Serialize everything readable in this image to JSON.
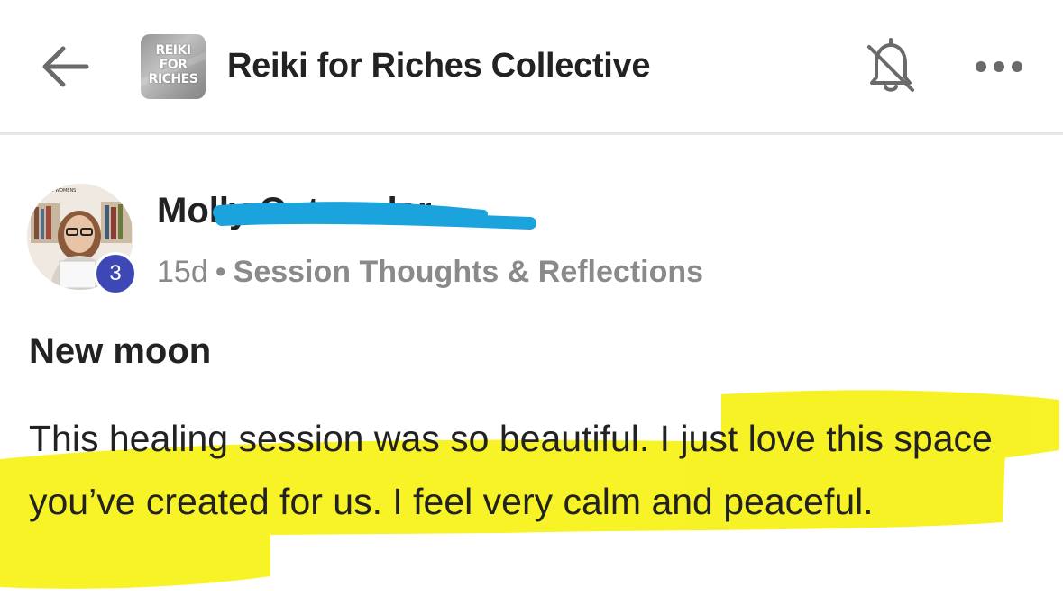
{
  "header": {
    "back_icon": "arrow-left-icon",
    "group_logo_text": "REIKI\nFOR\nRICHES",
    "group_title": "Reiki for Riches Collective",
    "bell_icon": "bell-off-icon",
    "more_icon": "more-horizontal-icon"
  },
  "post": {
    "author_name": "Molly Ostrander",
    "author_level": "3",
    "time_ago": "15d",
    "separator": "•",
    "category": "Session Thoughts & Reflections",
    "title": "New moon",
    "body": "This healing session was so beautiful. I just love this space you’ve created for us. I feel very calm and peaceful."
  },
  "colors": {
    "highlight": "#f7f21a",
    "redaction": "#1aa3dd",
    "level_badge": "#3d47b5",
    "text": "#222222",
    "muted": "#8a8a8a"
  }
}
